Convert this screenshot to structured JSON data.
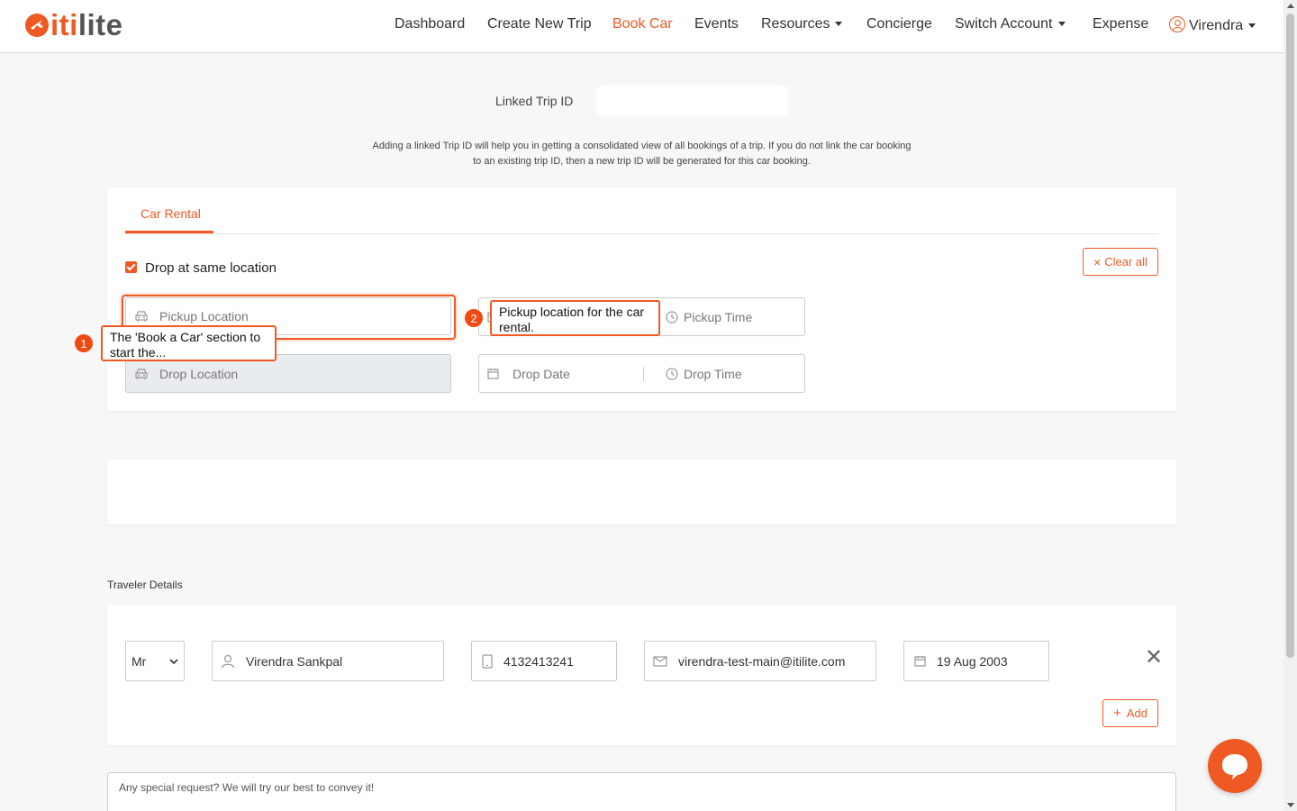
{
  "brand": {
    "logo_text_1": "iti",
    "logo_text_2": "lite",
    "accent_color": "#ef5a24"
  },
  "nav": {
    "items": [
      "Dashboard",
      "Create New Trip",
      "Book Car",
      "Events",
      "Resources",
      "Concierge",
      "Switch Account",
      "Expense"
    ],
    "active": "Book Car",
    "user": "Virendra"
  },
  "linked_trip": {
    "label": "Linked Trip ID",
    "value": "",
    "note_line1": "Adding a linked Trip ID will help you in getting a consolidated view of all bookings of a trip. If you do not link the car booking",
    "note_line2": "to an existing trip ID, then a new trip ID will be generated for this car booking."
  },
  "car_rental": {
    "tab": "Car Rental",
    "drop_same_label": "Drop at same location",
    "drop_same_checked": true,
    "clear_all": "Clear all",
    "pickup_location_placeholder": "Pickup Location",
    "drop_location_placeholder": "Drop Location",
    "pickup_time_placeholder": "Pickup Time",
    "drop_date_placeholder": "Drop Date",
    "drop_time_placeholder": "Drop Time"
  },
  "tooltips": [
    {
      "number": "1",
      "text": "The 'Book a Car' section to start the..."
    },
    {
      "number": "2",
      "text": "Pickup location for the car rental."
    }
  ],
  "traveler": {
    "section_label": "Traveler Details",
    "title_options": [
      "Mr"
    ],
    "title": "Mr",
    "name": "Virendra Sankpal",
    "phone": "4132413241",
    "email": "virendra-test-main@itilite.com",
    "dob": "19 Aug 2003",
    "add": "Add"
  },
  "special_request_placeholder": "Any special request? We will try our best to convey it!"
}
